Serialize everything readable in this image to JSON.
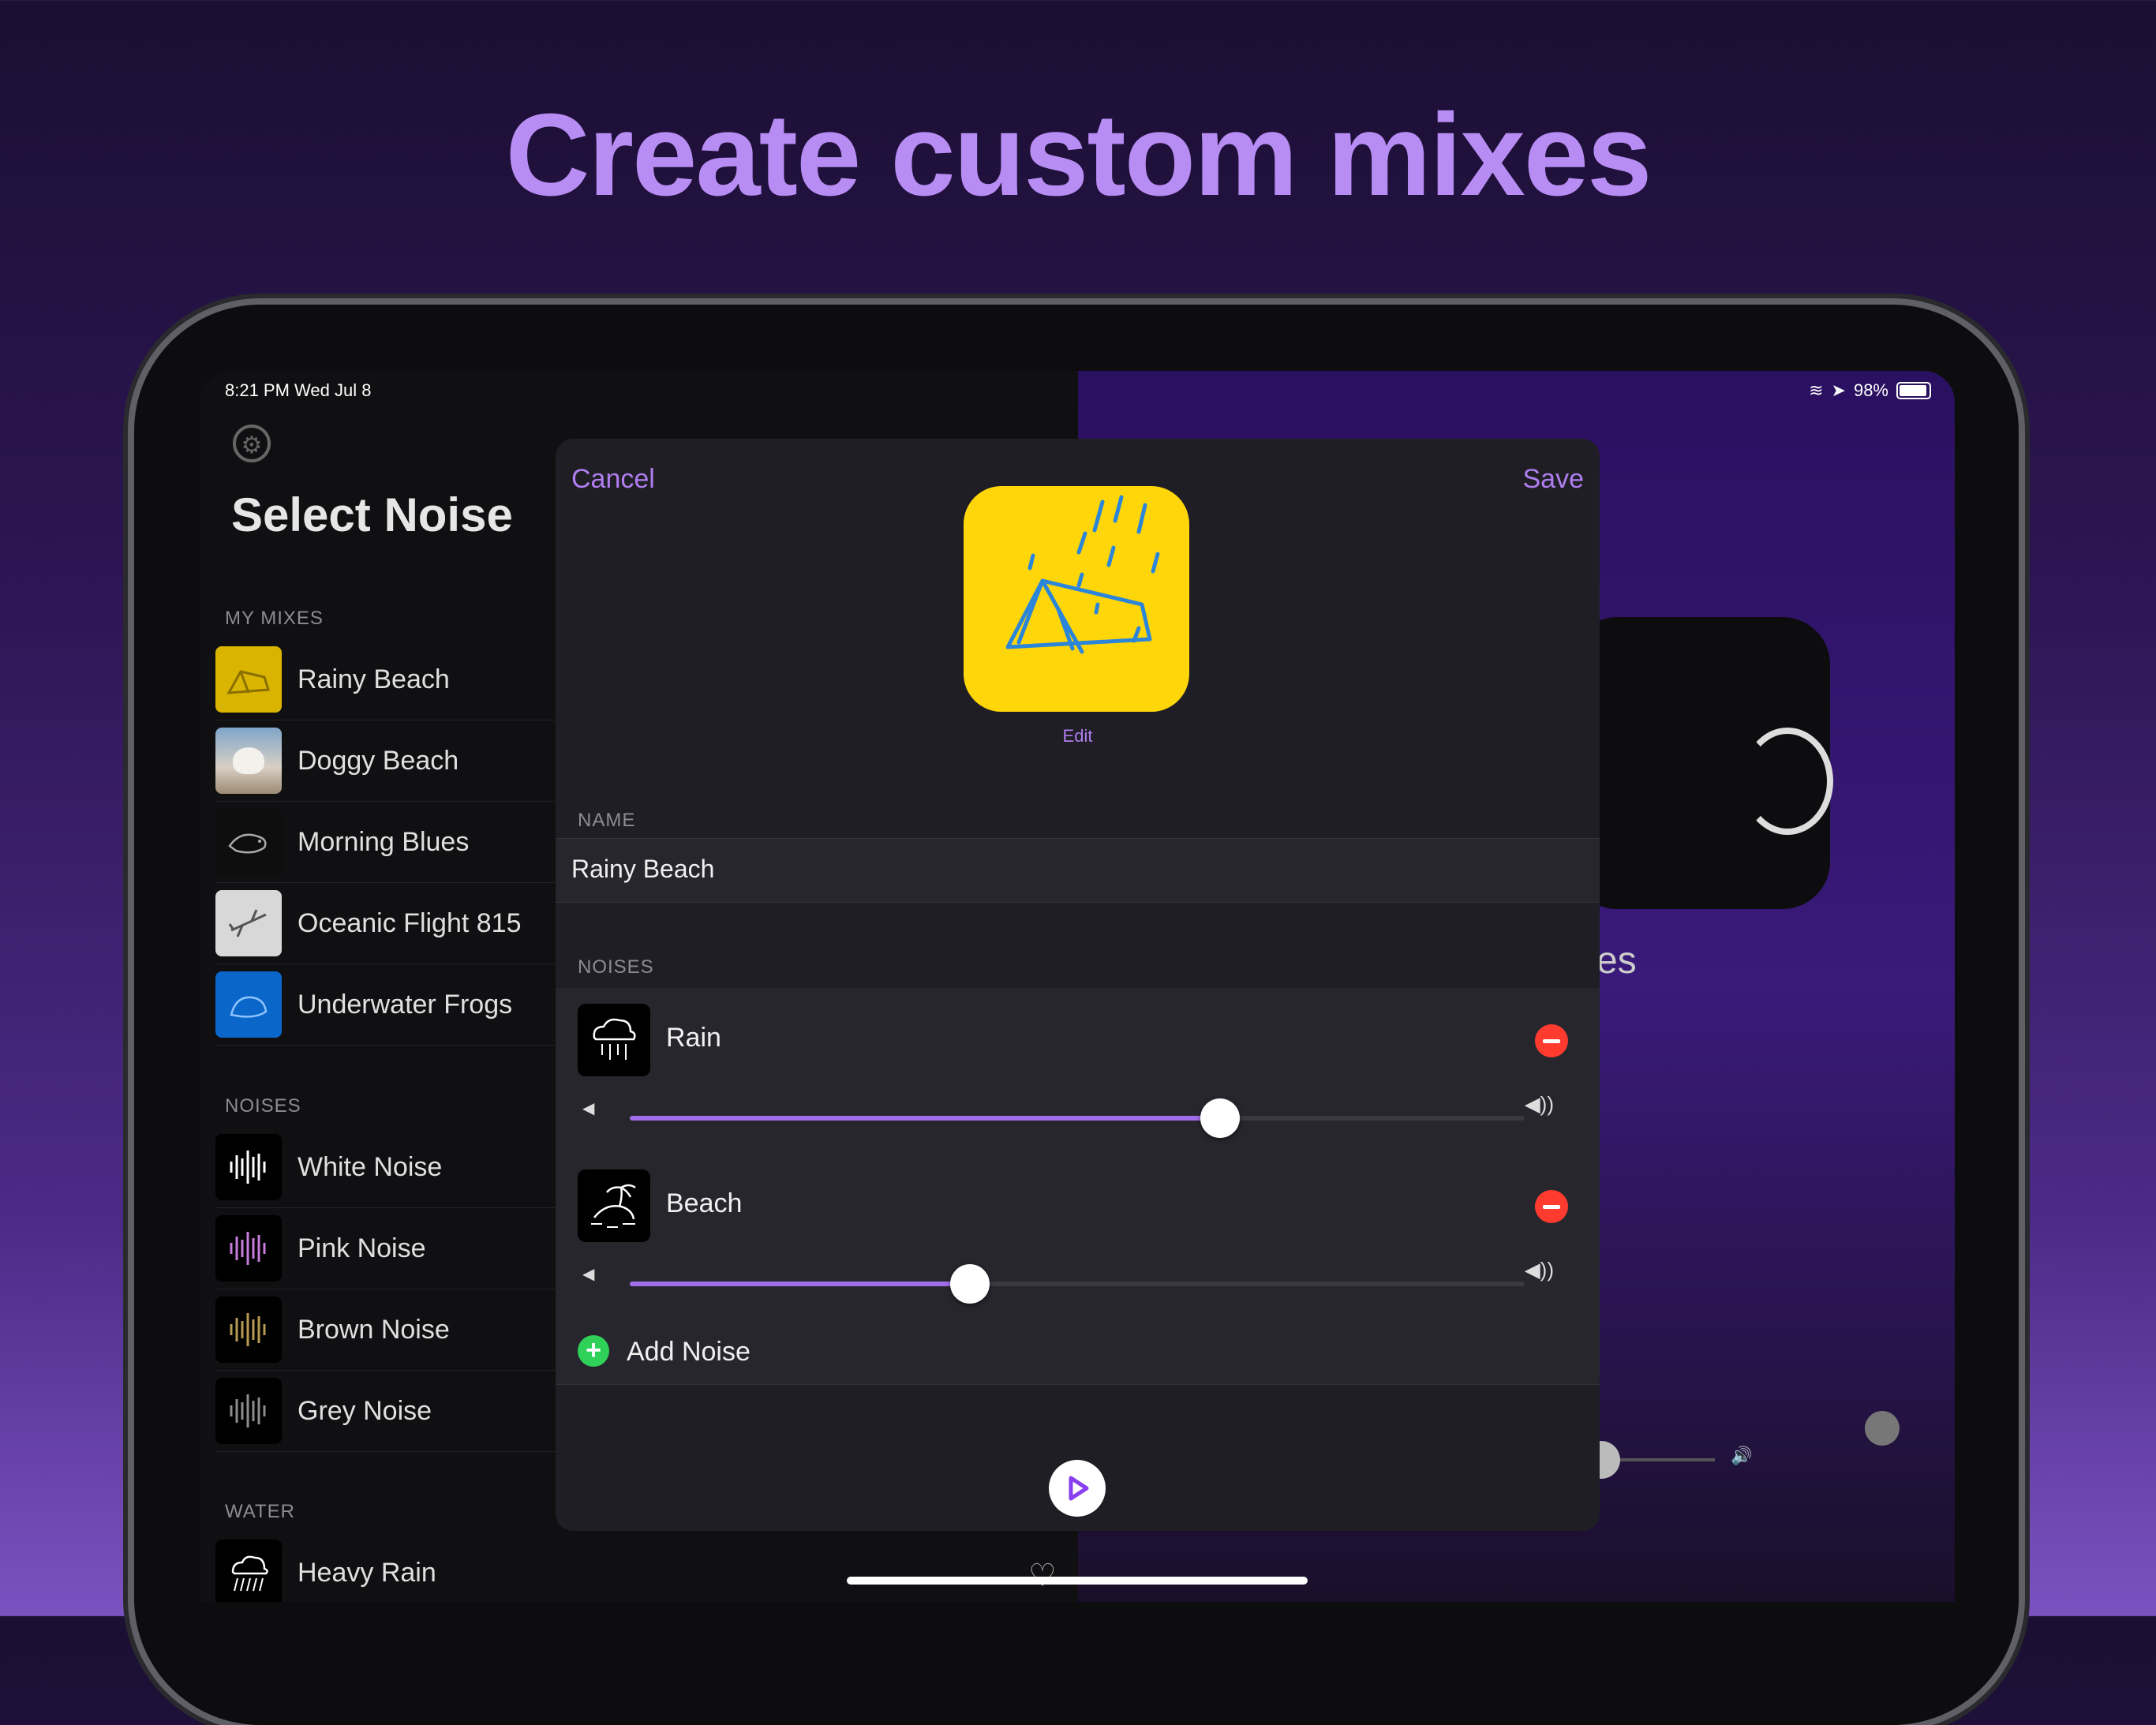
{
  "hero": {
    "title": "Create custom mixes"
  },
  "status_bar": {
    "time": "8:21 PM   Wed Jul 8",
    "battery": "98%"
  },
  "sidebar": {
    "title": "Select Noise",
    "sections": {
      "my_mixes": "MY MIXES",
      "noises": "NOISES",
      "water": "WATER"
    },
    "my_mixes": [
      {
        "label": "Rainy Beach",
        "icon": "tent-rain-icon"
      },
      {
        "label": "Doggy Beach",
        "icon": "dog-photo-icon"
      },
      {
        "label": "Morning Blues",
        "icon": "bird-icon"
      },
      {
        "label": "Oceanic Flight 815",
        "icon": "airplane-icon"
      },
      {
        "label": "Underwater Frogs",
        "icon": "frog-icon"
      }
    ],
    "noises": [
      {
        "label": "White Noise",
        "icon": "white-waveform-icon"
      },
      {
        "label": "Pink Noise",
        "icon": "pink-waveform-icon"
      },
      {
        "label": "Brown Noise",
        "icon": "brown-waveform-icon"
      },
      {
        "label": "Grey Noise",
        "icon": "grey-waveform-icon"
      }
    ],
    "water": [
      {
        "label": "Heavy Rain",
        "icon": "heavy-rain-icon"
      }
    ]
  },
  "player": {
    "partial_label": "es"
  },
  "modal": {
    "cancel": "Cancel",
    "save": "Save",
    "edit": "Edit",
    "name_label": "NAME",
    "name_value": "Rainy Beach",
    "noises_label": "NOISES",
    "noises": [
      {
        "name": "Rain",
        "icon": "cloud-rain-icon",
        "volume": 0.66
      },
      {
        "name": "Beach",
        "icon": "island-palm-icon",
        "volume": 0.38
      }
    ],
    "add_noise": "Add Noise"
  },
  "colors": {
    "accent": "#b07ef0",
    "slider_fill": "#a06ee8",
    "remove": "#ff3b30",
    "add": "#30d158",
    "mix_icon_bg": "#ffd60a"
  }
}
